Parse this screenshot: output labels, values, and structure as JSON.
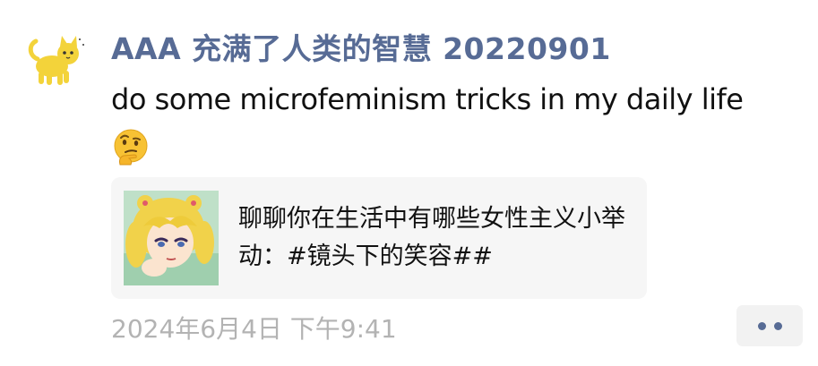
{
  "post": {
    "author": "AAA 充满了人类的智慧 20220901",
    "text": "do some microfeminism tricks in my daily life",
    "emoji_icon": "thinking-face-icon",
    "link": {
      "title": "聊聊你在生活中有哪些女性主义小举动：#镜头下的笑容##",
      "thumbnail_icon": "anime-girl-thumbnail"
    },
    "timestamp": "2024年6月4日 下午9:41"
  },
  "more_button": {
    "icon": "two-dots-icon"
  },
  "colors": {
    "author": "#576b95",
    "text": "#111111",
    "timestamp": "#b3b3b3",
    "card_bg": "#f6f6f6",
    "avatar_cat": "#f3d33a"
  }
}
